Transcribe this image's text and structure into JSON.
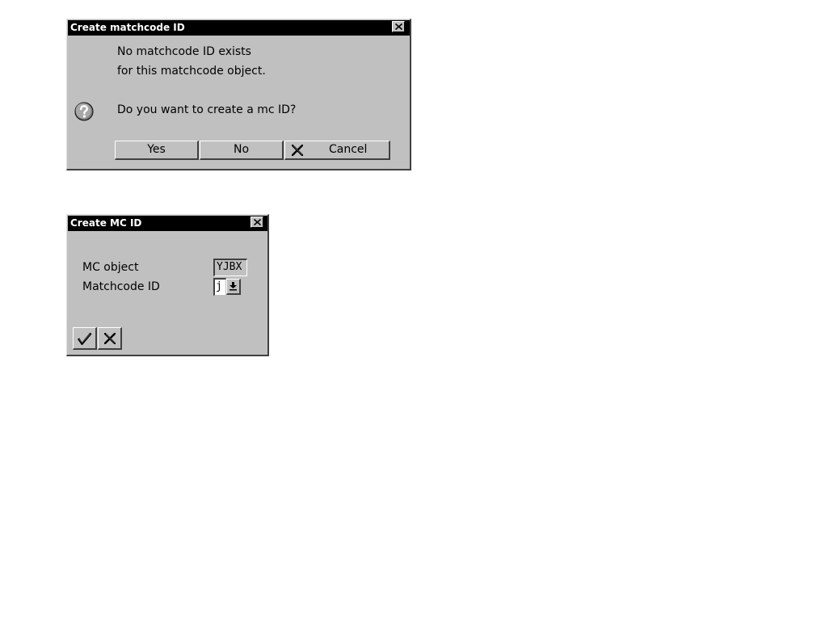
{
  "dialog1": {
    "title": "Create matchcode ID",
    "message_line1": "No matchcode ID exists",
    "message_line2": "for this matchcode object.",
    "question": "Do you want to create a mc ID?",
    "buttons": {
      "yes": "Yes",
      "no": "No",
      "cancel": "Cancel"
    },
    "icons": {
      "question": "question-icon",
      "close": "close-icon",
      "cancel": "x-icon"
    }
  },
  "dialog2": {
    "title": "Create MC ID",
    "fields": {
      "mc_object_label": "MC object",
      "mc_object_value": "YJBX",
      "matchcode_id_label": "Matchcode ID",
      "matchcode_id_value": "j"
    },
    "icons": {
      "close": "close-icon",
      "dropdown": "dropdown-arrow-icon",
      "confirm": "checkmark-icon",
      "cancel": "x-icon"
    }
  },
  "colors": {
    "dialog_bg": "#c0c0c0",
    "titlebar_bg": "#000000",
    "titlebar_text": "#ffffff"
  }
}
